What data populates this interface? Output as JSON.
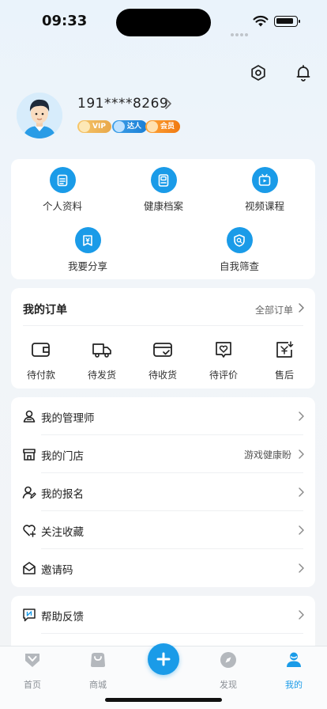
{
  "status_bar": {
    "time": "09:33"
  },
  "profile": {
    "phone": "191****8269",
    "badges": [
      "VIP",
      "达人",
      "会员"
    ]
  },
  "quick_actions": [
    {
      "label": "个人资料",
      "icon": "profile-doc-icon"
    },
    {
      "label": "健康档案",
      "icon": "health-record-icon"
    },
    {
      "label": "视频课程",
      "icon": "video-course-icon"
    },
    {
      "label": "我要分享",
      "icon": "share-icon"
    },
    {
      "label": "自我筛查",
      "icon": "self-screen-icon"
    }
  ],
  "orders": {
    "title": "我的订单",
    "all_label": "全部订单",
    "items": [
      {
        "label": "待付款",
        "icon": "wallet-icon"
      },
      {
        "label": "待发货",
        "icon": "truck-icon"
      },
      {
        "label": "待收货",
        "icon": "card-check-icon"
      },
      {
        "label": "待评价",
        "icon": "heart-review-icon"
      },
      {
        "label": "售后",
        "icon": "after-sale-icon"
      }
    ]
  },
  "menu": [
    {
      "label": "我的管理师",
      "value": "",
      "icon": "manager-icon"
    },
    {
      "label": "我的门店",
      "value": "游戏健康盼",
      "icon": "store-icon"
    },
    {
      "label": "我的报名",
      "value": "",
      "icon": "signup-icon"
    },
    {
      "label": "关注收藏",
      "value": "",
      "icon": "favorite-icon"
    },
    {
      "label": "邀请码",
      "value": "",
      "icon": "invite-icon"
    }
  ],
  "help": {
    "label": "帮助反馈",
    "icon": "feedback-icon"
  },
  "tabbar": {
    "items": [
      {
        "label": "首页",
        "active": false
      },
      {
        "label": "商城",
        "active": false
      },
      {
        "label": "发现",
        "active": false
      },
      {
        "label": "我的",
        "active": true
      }
    ]
  },
  "colors": {
    "accent": "#1a9be8"
  }
}
